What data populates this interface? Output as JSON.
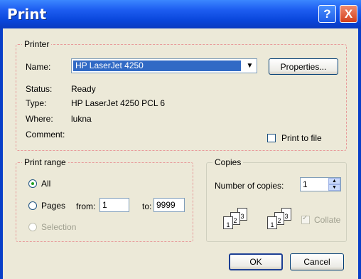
{
  "window": {
    "title": "Print"
  },
  "titlebar_buttons": {
    "help": "?",
    "close": "X"
  },
  "printer": {
    "legend": "Printer",
    "name_label": "Name:",
    "name_value": "HP LaserJet 4250",
    "properties_button": "Properties...",
    "status_label": "Status:",
    "status_value": "Ready",
    "type_label": "Type:",
    "type_value": "HP LaserJet 4250 PCL 6",
    "where_label": "Where:",
    "where_value": "lukna",
    "comment_label": "Comment:",
    "print_to_file": "Print to file"
  },
  "print_range": {
    "legend": "Print range",
    "all": "All",
    "pages": "Pages",
    "from_label": "from:",
    "from_value": "1",
    "to_label": "to:",
    "to_value": "9999",
    "selection": "Selection"
  },
  "copies": {
    "legend": "Copies",
    "number_label": "Number of copies:",
    "number_value": "1",
    "collate": "Collate",
    "collate_pages": [
      "1",
      "2",
      "3"
    ]
  },
  "buttons": {
    "ok": "OK",
    "cancel": "Cancel"
  }
}
